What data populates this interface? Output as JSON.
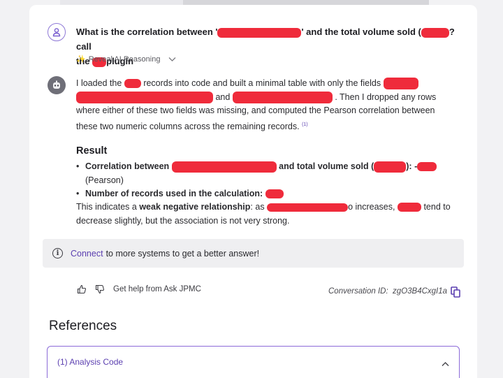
{
  "question": {
    "part1": "What is the correlation between '",
    "part2": "' and the total volume sold (",
    "part3": "?  call",
    "part4": "the",
    "part5": "plugin"
  },
  "reveal": {
    "icon": "sparkle-icon",
    "label": "Reveal AI Reasoning"
  },
  "answer": {
    "p1": "I loaded the",
    "p2": "records into code and built a minimal table with only the fields",
    "p3": "and",
    "p4": ". Then I dropped any rows where either of these two fields was missing, and computed the Pearson correlation between these two numeric columns across the remaining records.",
    "cite": "(1)"
  },
  "result": {
    "title": "Result",
    "b1a": "Correlation between",
    "b1b": "and total volume sold (",
    "b1c": "):",
    "b1d": "-",
    "b1e": "(Pearson)",
    "b2": "Number of records used in the calculation:",
    "t1": "This indicates a ",
    "t2": "weak negative relationship",
    "t3": ": as",
    "t4": "o increases,",
    "t5": "tend to decrease slightly, but the association is not very strong."
  },
  "connect": {
    "link": "Connect",
    "text": "to more systems to get a better answer!"
  },
  "feedback": {
    "help": "Get help from Ask JPMC"
  },
  "conversation": {
    "label": "Conversation ID:",
    "id": "zgO3B4CxgI1a"
  },
  "references": {
    "title": "References",
    "item1": "(1) Analysis Code"
  },
  "colors": {
    "accent": "#5b3fb0",
    "redaction": "#ef2b3b"
  }
}
